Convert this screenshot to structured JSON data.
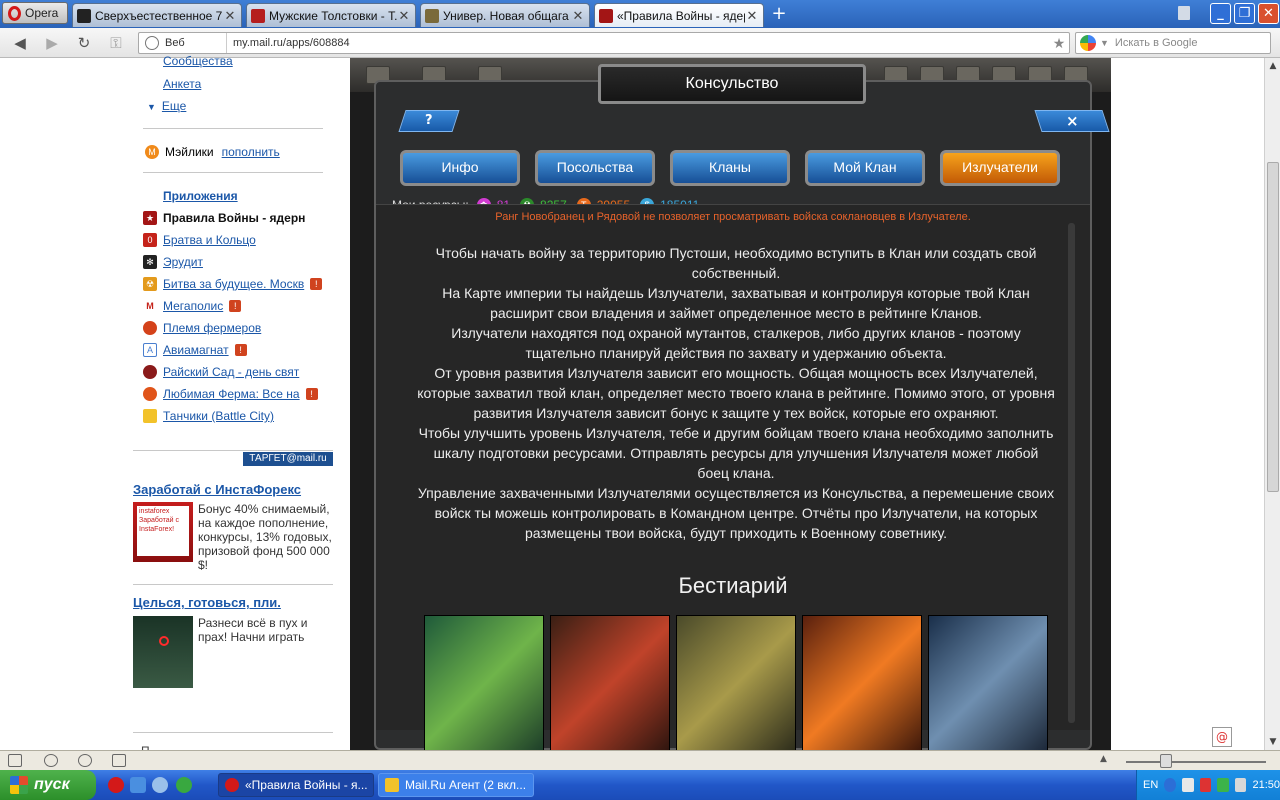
{
  "browser": {
    "menu_label": "Opera",
    "tabs": [
      {
        "title": "Сверхъестественное 7 ..."
      },
      {
        "title": "Мужские Толстовки - Т..."
      },
      {
        "title": "Универ. Новая общага ..."
      },
      {
        "title": "«Правила Войны - ядер..."
      }
    ],
    "address_prefix": "Веб",
    "url": "my.mail.ru/apps/608884",
    "search_placeholder": "Искать в Google"
  },
  "sidebar": {
    "top_links": [
      "Сообщества",
      "Анкета",
      "Еще"
    ],
    "mailiki_label": "Мэйлики",
    "mailiki_action": "пополнить",
    "apps_heading": "Приложения",
    "apps": [
      {
        "label": "Правила Войны - ядерн",
        "active": true,
        "warn": false
      },
      {
        "label": "Братва и Кольцо",
        "warn": false
      },
      {
        "label": "Эрудит",
        "warn": false
      },
      {
        "label": "Битва за будущее. Москв",
        "warn": true
      },
      {
        "label": "Мегаполис",
        "warn": true
      },
      {
        "label": "Племя фермеров",
        "warn": false
      },
      {
        "label": "Авиамагнат",
        "warn": true
      },
      {
        "label": "Райский Сад - день свят",
        "warn": false
      },
      {
        "label": "Любимая Ферма: Все на",
        "warn": true
      },
      {
        "label": "Танчики (Battle City)",
        "warn": false
      }
    ],
    "target_badge": "ТАРГЕТ@mail.ru",
    "ads": [
      {
        "title": "Заработай с ИнстаФорекс",
        "text": "Бонус 40% снимаемый, на каждое пополнение, конкурсы, 13% годовых, призовой фонд 500 000 $!",
        "img_caption": "instaforex Заработай с InstaForex!"
      },
      {
        "title": "Целься, готовься, пли.",
        "text": "Разнеси всё в пух и прах! Начни играть"
      }
    ],
    "bottom_hint": "П"
  },
  "game": {
    "dialog_title": "Консульство",
    "help_label": "?",
    "close_label": "×",
    "tabs": [
      {
        "label": "Инфо",
        "active": false
      },
      {
        "label": "Посольства",
        "active": false
      },
      {
        "label": "Кланы",
        "active": false
      },
      {
        "label": "Мой Клан",
        "active": false
      },
      {
        "label": "Излучатели",
        "active": true
      }
    ],
    "resources_label": "Мои ресурсы:",
    "resources": [
      {
        "icon": "crystal-icon",
        "value": "81",
        "color": "#d13bd1"
      },
      {
        "icon": "radiation-icon",
        "value": "8257",
        "color": "#3dbf3a"
      },
      {
        "icon": "titanium-icon",
        "value": "29055",
        "color": "#e86a1c"
      },
      {
        "icon": "money-icon",
        "value": "185011",
        "color": "#3aa6d9"
      }
    ],
    "rank_warning": "Ранг Новобранец и Рядовой не позволяет просматривать войска соклановцев в Излучателе.",
    "paragraphs": [
      "Чтобы начать войну за территорию Пустоши, необходимо вступить в Клан или создать свой собственный.",
      "На Карте империи ты найдешь Излучатели, захватывая и контролируя которые твой Клан расширит свои владения и займет определенное место в рейтинге Кланов.",
      "Излучатели находятся под охраной мутантов, сталкеров, либо других кланов - поэтому тщательно планируй действия по захвату и удержанию объекта.",
      "От уровня развития Излучателя зависит его мощность. Общая мощность всех Излучателей, которые захватил твой клан, определяет место твоего клана в рейтинге. Помимо этого, от уровня развития Излучателя зависит бонус к защите у тех войск, которые его охраняют.",
      "Чтобы улучшить уровень Излучателя, тебе и другим бойцам твоего клана необходимо заполнить шкалу подготовки ресурсами. Отправлять ресурсы для улучшения Излучателя может любой боец клана.",
      "Управление захваченными Излучателями осуществляется из Консульства, а перемешение своих войск ты можешь контролировать в Командном центре. Отчёты про Излучатели, на которых размещены твои войска, будут приходить к Военному советнику."
    ],
    "bestiary_heading": "Бестиарий"
  },
  "taskbar": {
    "start_label": "пуск",
    "tasks": [
      {
        "label": "«Правила Войны - я..."
      },
      {
        "label": "Mail.Ru Агент (2 вкл..."
      }
    ],
    "lang": "EN",
    "clock": "21:50"
  }
}
